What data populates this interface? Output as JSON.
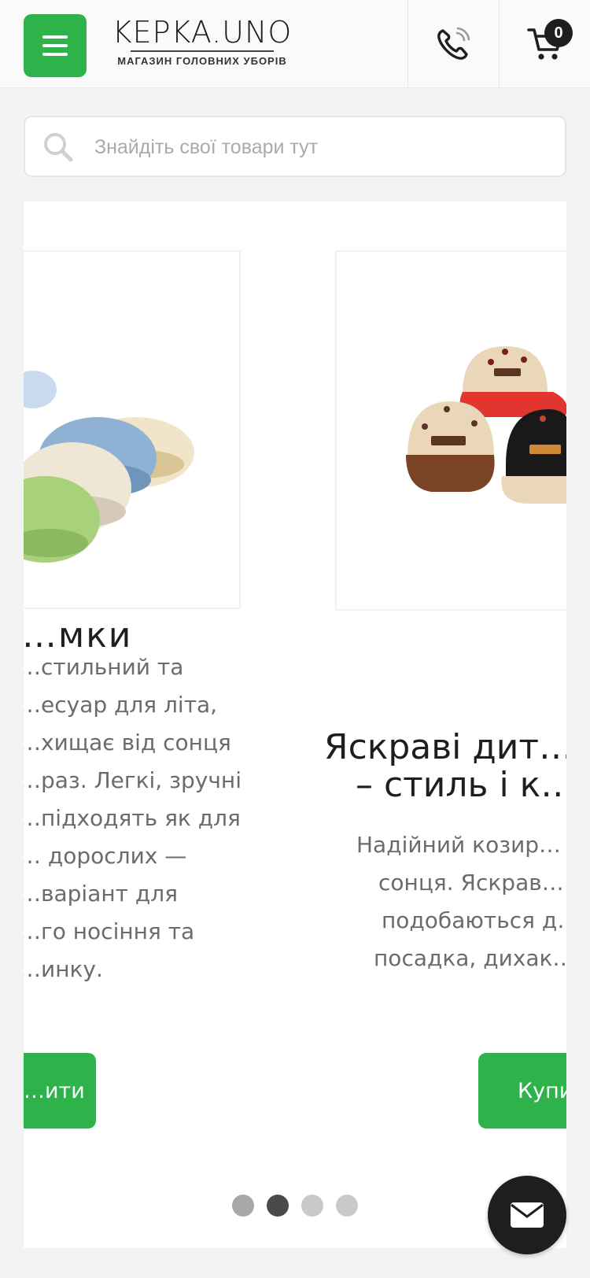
{
  "header": {
    "logo_title": "KEPKA.UNO",
    "logo_subtitle": "МАГАЗИН ГОЛОВНИХ УБОРІВ",
    "cart_count": "0",
    "brand_color": "#2db34a"
  },
  "search": {
    "placeholder": "Знайдіть свої товари тут"
  },
  "slider": {
    "slides": [
      {
        "title": "…мки",
        "description_lines": [
          "…стильний та",
          "…есуар для літа,",
          "…хищає від сонця",
          "…раз. Легкі, зручні",
          "…підходять як для",
          "… дорослих —",
          "…варіант для",
          "…го носіння та",
          "…инку."
        ],
        "button_label": "…ити",
        "image_icon": "bucket-hats-image"
      },
      {
        "title_lines": [
          "Яскраві дит…",
          "– стиль і к…"
        ],
        "description_lines": [
          "Надійний козир…",
          "сонця. Яскрав…",
          "подобаються д…",
          "посадка, дихак…"
        ],
        "button_label": "Купи…",
        "image_icon": "kids-caps-image"
      }
    ],
    "dots_count": 4,
    "active_dot": 1
  },
  "icons": {
    "menu": "hamburger-icon",
    "phone": "phone-icon",
    "cart": "cart-icon",
    "search": "search-icon",
    "mail": "mail-icon"
  }
}
